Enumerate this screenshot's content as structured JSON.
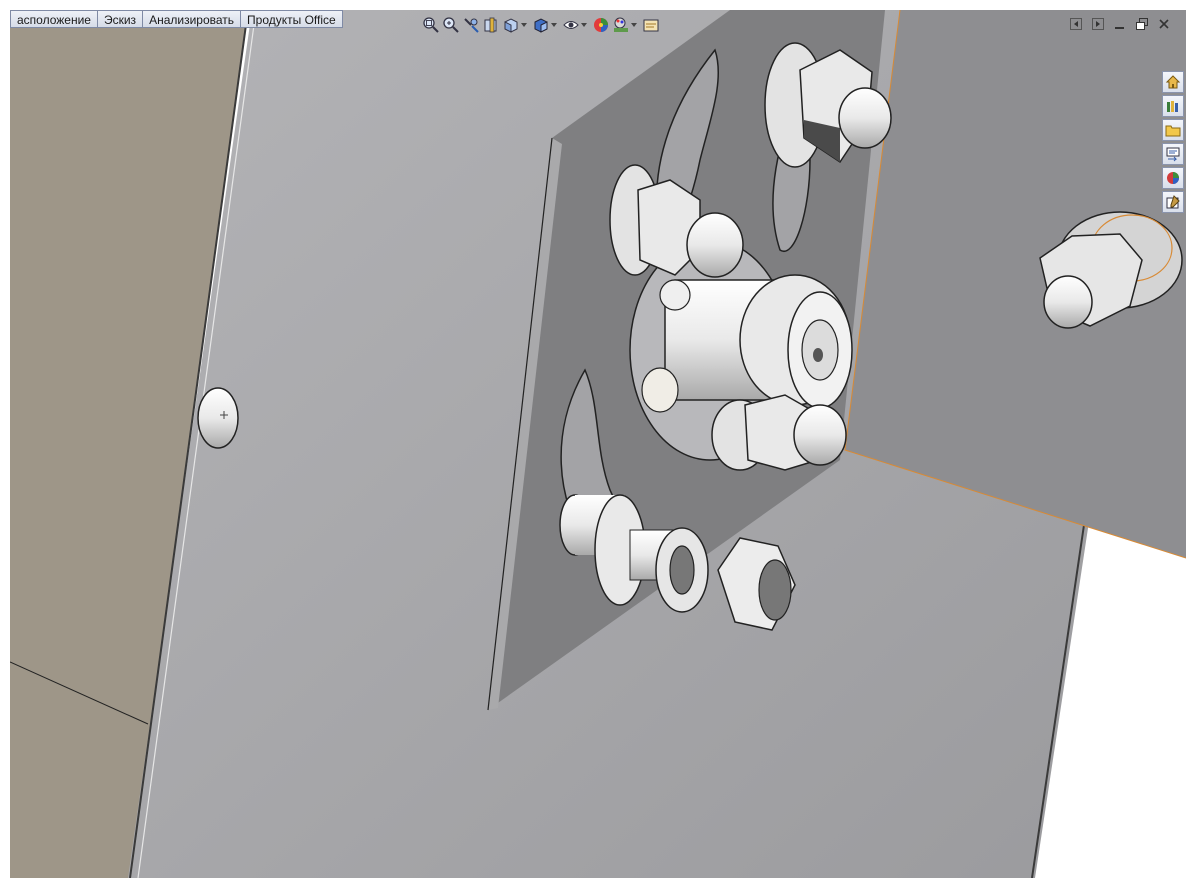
{
  "command_tabs": [
    {
      "label": "асположение"
    },
    {
      "label": "Эскиз"
    },
    {
      "label": "Анализировать"
    },
    {
      "label": "Продукты Office"
    }
  ],
  "view_toolbar": [
    {
      "icon": "zoom-to-fit-icon",
      "has_dropdown": false
    },
    {
      "icon": "zoom-to-area-icon",
      "has_dropdown": false
    },
    {
      "icon": "previous-view-icon",
      "has_dropdown": false
    },
    {
      "icon": "section-view-icon",
      "has_dropdown": false
    },
    {
      "icon": "view-orientation-icon",
      "has_dropdown": true
    },
    {
      "icon": "display-style-icon",
      "has_dropdown": true
    },
    {
      "icon": "hide-show-items-icon",
      "has_dropdown": true
    },
    {
      "icon": "edit-appearance-icon",
      "has_dropdown": false
    },
    {
      "icon": "apply-scene-icon",
      "has_dropdown": true
    },
    {
      "icon": "view-settings-icon",
      "has_dropdown": false
    }
  ],
  "window_controls": [
    {
      "icon": "prev-window-icon"
    },
    {
      "icon": "next-window-icon"
    },
    {
      "icon": "minimize-icon"
    },
    {
      "icon": "restore-icon"
    },
    {
      "icon": "close-icon"
    }
  ],
  "task_pane": [
    {
      "icon": "home-icon",
      "color": "#c89a2e"
    },
    {
      "icon": "design-library-icon",
      "color": "#3a7d3a"
    },
    {
      "icon": "file-explorer-icon",
      "color": "#e3b13b"
    },
    {
      "icon": "view-palette-icon",
      "color": "#3a5fa8"
    },
    {
      "icon": "appearances-icon",
      "color": "#d23c3c"
    },
    {
      "icon": "custom-properties-icon",
      "color": "#c59a44"
    }
  ],
  "colors": {
    "background": "#ffffff",
    "main_plate": "#a3a3a6",
    "left_plate": "#9e9688",
    "mounting_plate": "#7f7f81",
    "right_part": "#8e8e91",
    "selection_edge": "#d88a35",
    "hardware": "#e6e6e6"
  }
}
